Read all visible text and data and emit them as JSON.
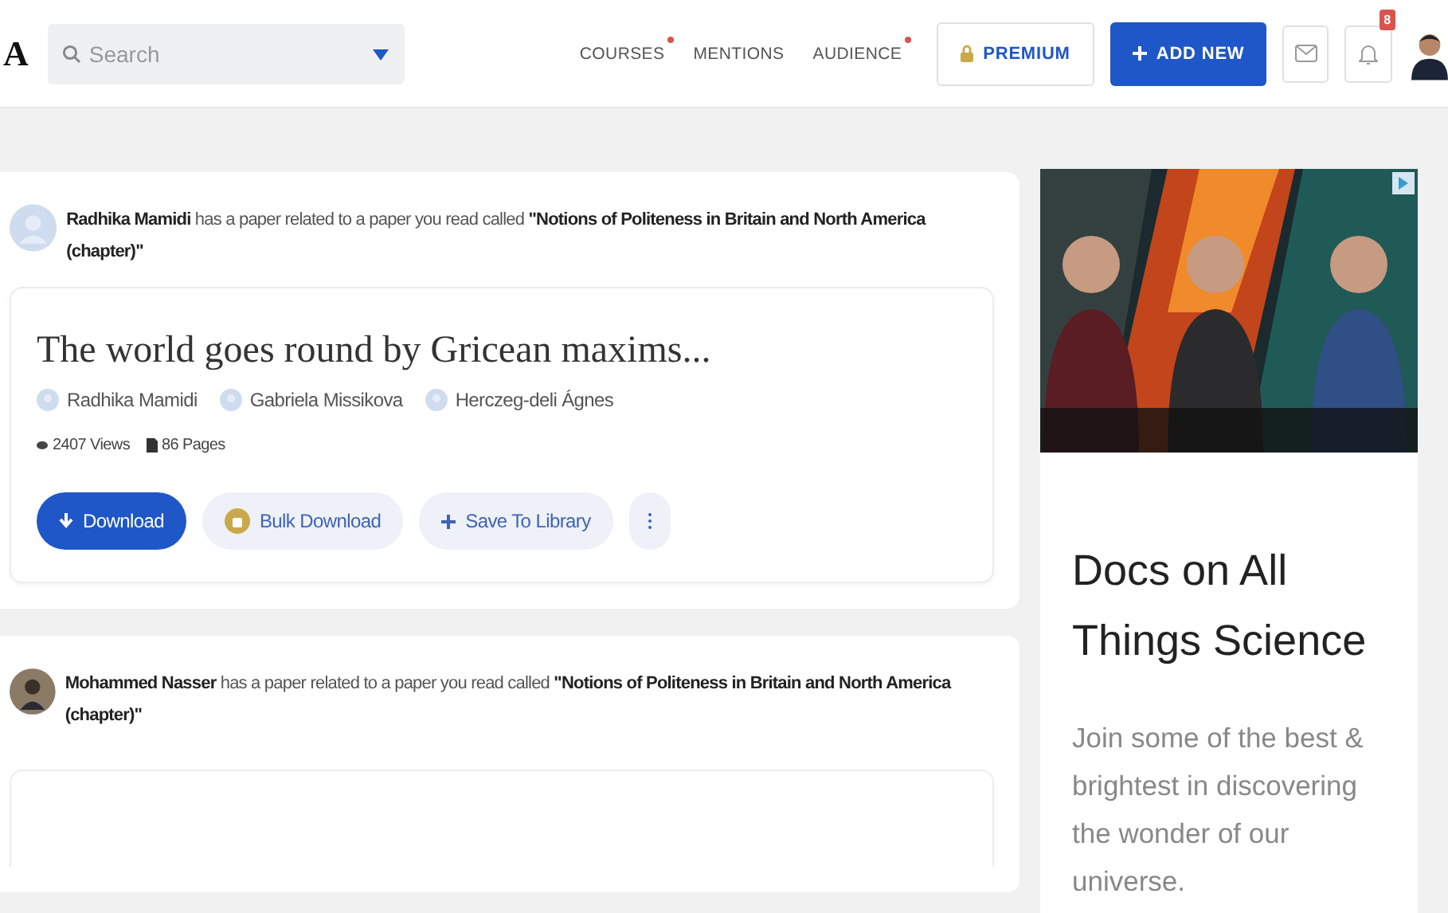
{
  "header": {
    "logo": "A",
    "search": {
      "placeholder": "Search"
    },
    "nav": [
      {
        "label": "COURSES",
        "dot": true
      },
      {
        "label": "MENTIONS",
        "dot": false
      },
      {
        "label": "AUDIENCE",
        "dot": true
      }
    ],
    "premium": "PREMIUM",
    "add_new": "ADD NEW",
    "notification_count": "8"
  },
  "feed": [
    {
      "avatar": {
        "kind": "placeholder"
      },
      "message": "**Radhika Mamidi** has a paper related to a paper you read called **\"Notions of Politeness in Britain and North America (chapter)\"**",
      "paper": {
        "title": "The world goes round by Gricean maxims...",
        "authors": [
          "Radhika Mamidi",
          "Gabriela Missikova",
          "Herczeg-deli Ágnes"
        ],
        "views": "2407 Views",
        "pages": "86 Pages",
        "actions": [
          {
            "label": "Download",
            "kind": "primary"
          },
          {
            "label": "Bulk Download",
            "kind": "bulk"
          },
          {
            "label": "Save To Library",
            "kind": "save"
          }
        ]
      }
    },
    {
      "message": "**Mohammed Nasser** has a paper related to a paper you read called **\"Notions of Politeness in Britain and North America (chapter)\"**"
    }
  ],
  "ad": {
    "title": "Docs on All Things Science",
    "body": "Join some of the best & brightest in discovering the wonder of our universe."
  }
}
